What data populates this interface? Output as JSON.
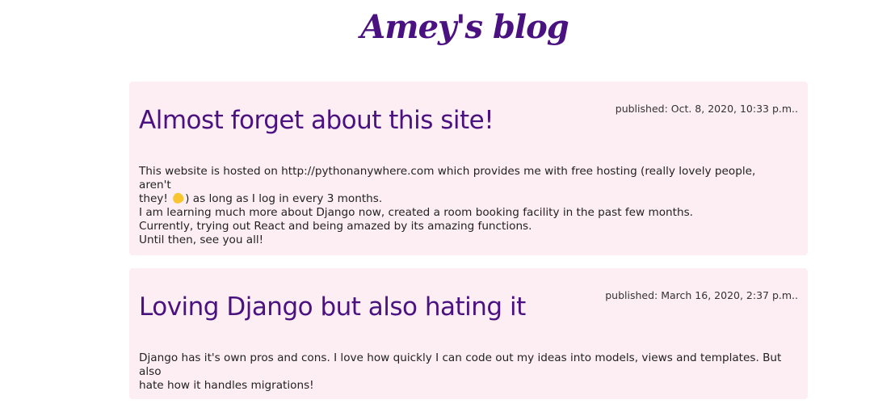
{
  "site": {
    "title": "Amey's blog"
  },
  "posts": [
    {
      "published": "published: Oct. 8, 2020, 10:33 p.m..",
      "title": "Almost forget about this site!",
      "body_line1_a": "This website is hosted on http://pythonanywhere.com which provides me with free hosting (really lovely people, aren't",
      "body_line2_a": "they!",
      "body_line2_emoji": "yellow-heart-icon",
      "body_line2_b": ") as long as I log in every 3 months.",
      "body_line3": "I am learning much more about Django now, created a room booking facility in the past few months.",
      "body_line4": "Currently, trying out React and being amazed by its amazing functions.",
      "body_line5": "Until then, see you all!"
    },
    {
      "published": "published: March 16, 2020, 2:37 p.m..",
      "title": "Loving Django but also hating it",
      "body_line1": "Django has it's own pros and cons. I love how quickly I can code out my ideas into models, views and templates. But also",
      "body_line2": "hate how it handles migrations!"
    }
  ],
  "colors": {
    "title": "#4a1280",
    "post_background": "#fdeef3",
    "text": "#222222"
  }
}
